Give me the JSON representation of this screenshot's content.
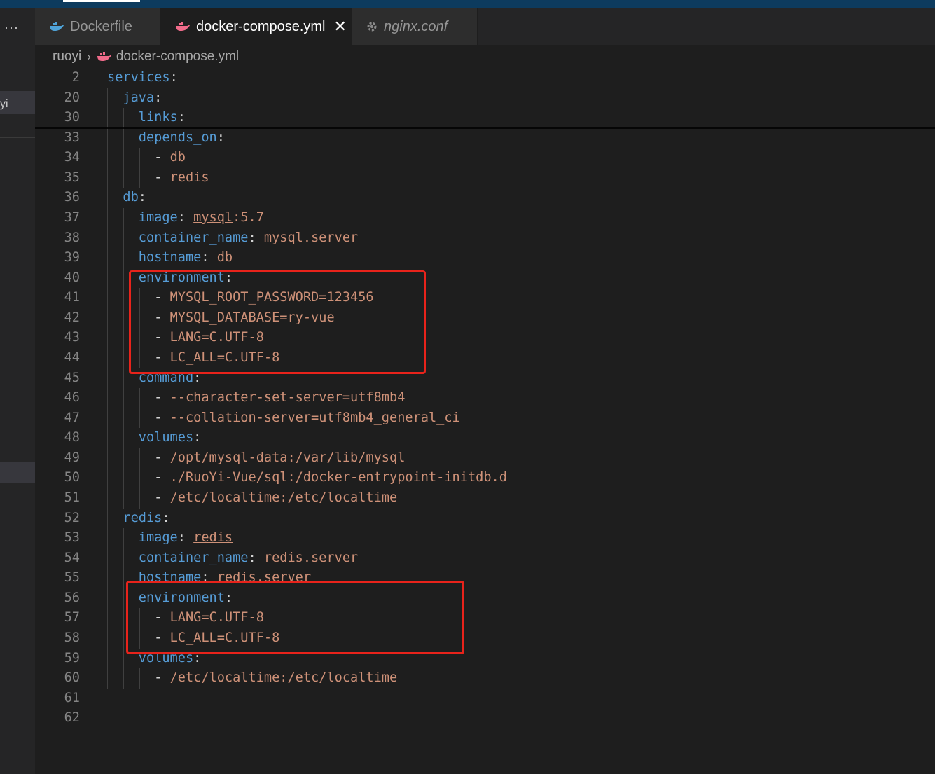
{
  "tabs": [
    {
      "label": "Dockerfile",
      "icon": "docker-whale-icon",
      "active": false,
      "italic": false
    },
    {
      "label": "docker-compose.yml",
      "icon": "docker-compose-icon",
      "active": true,
      "italic": false,
      "close": "✕"
    },
    {
      "label": "nginx.conf",
      "icon": "gear-icon",
      "active": false,
      "italic": true
    }
  ],
  "sidebar": {
    "more": "···",
    "row_label": "yi"
  },
  "breadcrumb": {
    "folder": "ruoyi",
    "separator": "›",
    "file": "docker-compose.yml"
  },
  "colors": {
    "key": "#569cd6",
    "value": "#ce9178",
    "highlight_box": "#e8231b",
    "docker_blue": "#4fa3d8",
    "compose_pink": "#f06b8a"
  },
  "editor": {
    "lines": [
      {
        "n": "2",
        "indent": "",
        "key": "services",
        "colon": ":"
      },
      {
        "n": "20",
        "indent": "  ",
        "key": "java",
        "colon": ":"
      },
      {
        "n": "30",
        "indent": "    ",
        "key": "links",
        "colon": ":"
      },
      {
        "n": "33",
        "indent": "    ",
        "key": "depends_on",
        "colon": ":"
      },
      {
        "n": "34",
        "indent": "      ",
        "dash": "- ",
        "value": "db"
      },
      {
        "n": "35",
        "indent": "      ",
        "dash": "- ",
        "value": "redis"
      },
      {
        "n": "36",
        "indent": "  ",
        "key": "db",
        "colon": ":"
      },
      {
        "n": "37",
        "indent": "    ",
        "key": "image",
        "colon": ": ",
        "value_ul": "mysql",
        "value": ":5.7"
      },
      {
        "n": "38",
        "indent": "    ",
        "key": "container_name",
        "colon": ": ",
        "value": "mysql.server"
      },
      {
        "n": "39",
        "indent": "    ",
        "key": "hostname",
        "colon": ": ",
        "value": "db"
      },
      {
        "n": "40",
        "indent": "    ",
        "key": "environment",
        "colon": ":"
      },
      {
        "n": "41",
        "indent": "      ",
        "dash": "- ",
        "value": "MYSQL_ROOT_PASSWORD=123456"
      },
      {
        "n": "42",
        "indent": "      ",
        "dash": "- ",
        "value": "MYSQL_DATABASE=ry-vue"
      },
      {
        "n": "43",
        "indent": "      ",
        "dash": "- ",
        "value": "LANG=C.UTF-8"
      },
      {
        "n": "44",
        "indent": "      ",
        "dash": "- ",
        "value": "LC_ALL=C.UTF-8"
      },
      {
        "n": "45",
        "indent": "    ",
        "key": "command",
        "colon": ":"
      },
      {
        "n": "46",
        "indent": "      ",
        "dash": "- ",
        "value": "--character-set-server=utf8mb4"
      },
      {
        "n": "47",
        "indent": "      ",
        "dash": "- ",
        "value": "--collation-server=utf8mb4_general_ci"
      },
      {
        "n": "48",
        "indent": "    ",
        "key": "volumes",
        "colon": ":"
      },
      {
        "n": "49",
        "indent": "      ",
        "dash": "- ",
        "value": "/opt/mysql-data:/var/lib/mysql"
      },
      {
        "n": "50",
        "indent": "      ",
        "dash": "- ",
        "value": "./RuoYi-Vue/sql:/docker-entrypoint-initdb.d"
      },
      {
        "n": "51",
        "indent": "      ",
        "dash": "- ",
        "value": "/etc/localtime:/etc/localtime"
      },
      {
        "n": "52",
        "indent": "  ",
        "key": "redis",
        "colon": ":"
      },
      {
        "n": "53",
        "indent": "    ",
        "key": "image",
        "colon": ": ",
        "value_ul": "redis"
      },
      {
        "n": "54",
        "indent": "    ",
        "key": "container_name",
        "colon": ": ",
        "value": "redis.server"
      },
      {
        "n": "55",
        "indent": "    ",
        "key": "hostname",
        "colon": ": ",
        "value": "redis.server"
      },
      {
        "n": "56",
        "indent": "    ",
        "key": "environment",
        "colon": ":"
      },
      {
        "n": "57",
        "indent": "      ",
        "dash": "- ",
        "value": "LANG=C.UTF-8"
      },
      {
        "n": "58",
        "indent": "      ",
        "dash": "- ",
        "value": "LC_ALL=C.UTF-8"
      },
      {
        "n": "59",
        "indent": "    ",
        "key": "volumes",
        "colon": ":"
      },
      {
        "n": "60",
        "indent": "      ",
        "dash": "- ",
        "value": "/etc/localtime:/etc/localtime"
      },
      {
        "n": "61",
        "indent": ""
      },
      {
        "n": "62",
        "indent": ""
      }
    ]
  }
}
